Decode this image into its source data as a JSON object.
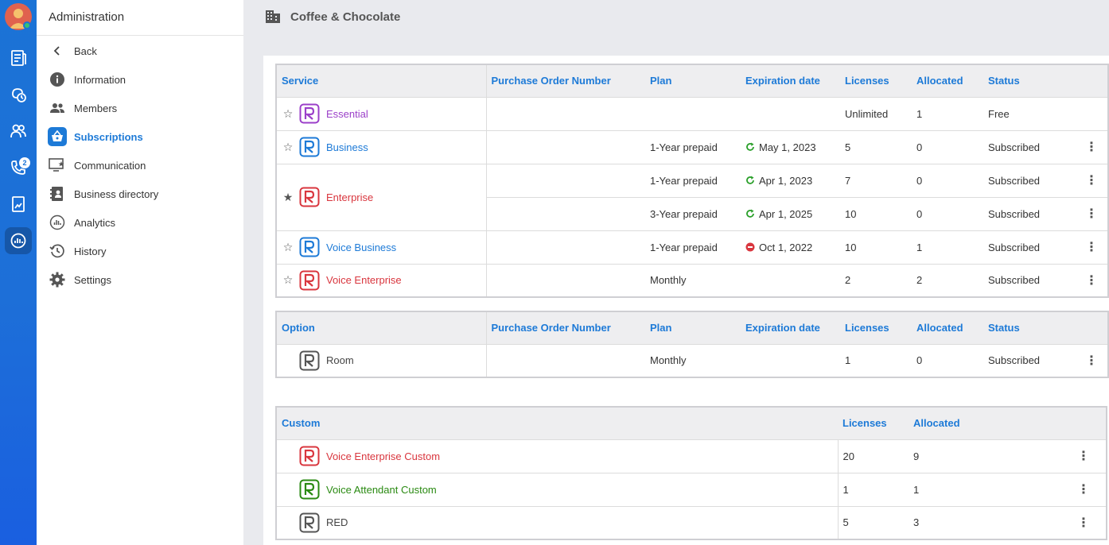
{
  "sidebar": {
    "title": "Administration",
    "items": [
      {
        "label": "Back"
      },
      {
        "label": "Information"
      },
      {
        "label": "Members"
      },
      {
        "label": "Subscriptions"
      },
      {
        "label": "Communication"
      },
      {
        "label": "Business directory"
      },
      {
        "label": "Analytics"
      },
      {
        "label": "History"
      },
      {
        "label": "Settings"
      }
    ]
  },
  "rail": {
    "calls_badge": "2"
  },
  "header": {
    "title": "Coffee & Chocolate"
  },
  "services": {
    "headers": {
      "service": "Service",
      "po": "Purchase Order Number",
      "plan": "Plan",
      "exp": "Expiration date",
      "licenses": "Licenses",
      "allocated": "Allocated",
      "status": "Status"
    },
    "rows": [
      {
        "name": "Essential",
        "color": "#9b3fc9",
        "starred": false,
        "plan": "",
        "exp": "",
        "exp_state": "none",
        "licenses": "Unlimited",
        "allocated": "1",
        "status": "Free",
        "menu": false
      },
      {
        "name": "Business",
        "color": "#1d7ad7",
        "starred": false,
        "plan": "1-Year prepaid",
        "exp": "May 1, 2023",
        "exp_state": "renew",
        "licenses": "5",
        "allocated": "0",
        "status": "Subscribed",
        "menu": true
      },
      {
        "name": "Enterprise",
        "color": "#d9363e",
        "starred": true,
        "plan": "1-Year prepaid",
        "exp": "Apr 1, 2023",
        "exp_state": "renew",
        "licenses": "7",
        "allocated": "0",
        "status": "Subscribed",
        "menu": true,
        "plan2": "3-Year prepaid",
        "exp2": "Apr 1, 2025",
        "licenses2": "10",
        "allocated2": "0",
        "status2": "Subscribed"
      },
      {
        "name": "Voice Business",
        "color": "#1d7ad7",
        "starred": false,
        "plan": "1-Year prepaid",
        "exp": "Oct 1, 2022",
        "exp_state": "stopped",
        "licenses": "10",
        "allocated": "1",
        "status": "Subscribed",
        "menu": true
      },
      {
        "name": "Voice Enterprise",
        "color": "#d9363e",
        "starred": false,
        "plan": "Monthly",
        "exp": "",
        "exp_state": "none",
        "licenses": "2",
        "allocated": "2",
        "status": "Subscribed",
        "menu": true
      }
    ]
  },
  "options": {
    "headers": {
      "option": "Option",
      "po": "Purchase Order Number",
      "plan": "Plan",
      "exp": "Expiration date",
      "licenses": "Licenses",
      "allocated": "Allocated",
      "status": "Status"
    },
    "rows": [
      {
        "name": "Room",
        "color": "#555555",
        "plan": "Monthly",
        "exp": "",
        "licenses": "1",
        "allocated": "0",
        "status": "Subscribed"
      }
    ]
  },
  "custom": {
    "headers": {
      "custom": "Custom",
      "licenses": "Licenses",
      "allocated": "Allocated"
    },
    "rows": [
      {
        "name": "Voice Enterprise Custom",
        "color": "#d9363e",
        "licenses": "20",
        "allocated": "9"
      },
      {
        "name": "Voice Attendant Custom",
        "color": "#2a8a12",
        "licenses": "1",
        "allocated": "1"
      },
      {
        "name": "RED",
        "color": "#555555",
        "licenses": "5",
        "allocated": "3"
      }
    ]
  },
  "colors": {
    "accent": "#1d7ad7",
    "renew": "#2ca02c",
    "stopped": "#d9363e"
  }
}
